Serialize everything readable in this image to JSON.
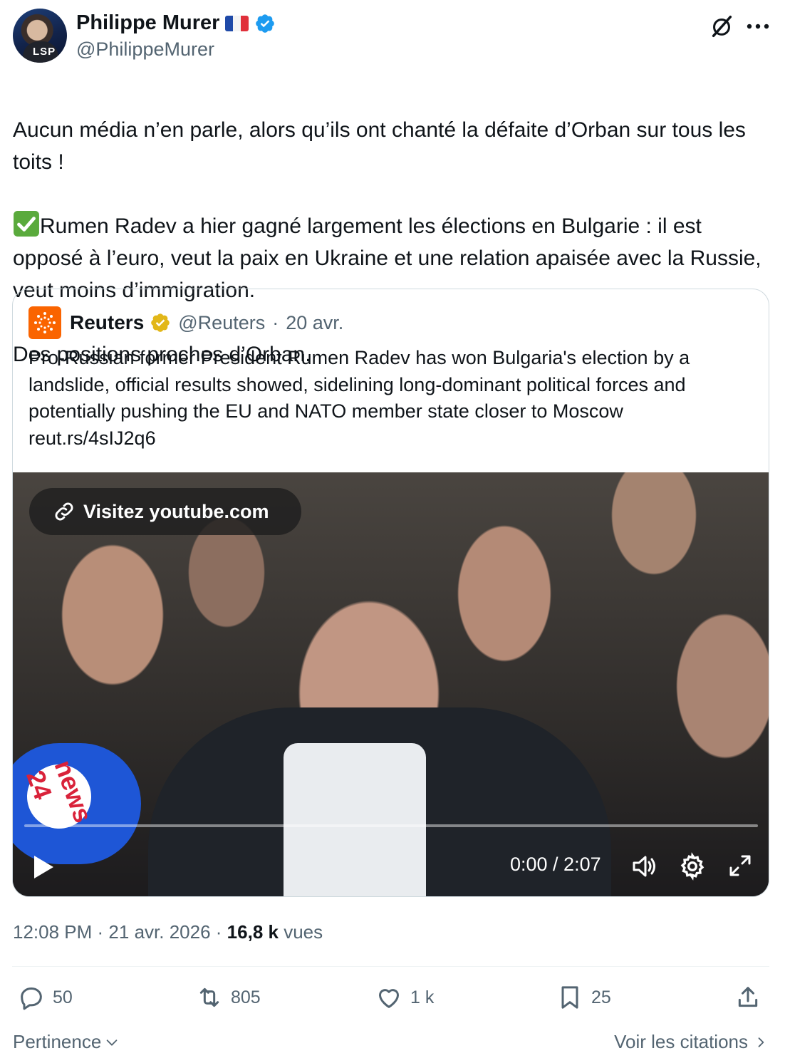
{
  "author": {
    "name": "Philippe Murer",
    "handle": "@PhilippeMurer",
    "avatar_text": "LSP",
    "verified_color": "#1d9bf0"
  },
  "tweet": {
    "text": "Aucun média n’en parle, alors qu’ils ont chanté la défaite d’Orban sur tous les toits !",
    "check_line": "Rumen Radev a hier gagné largement les élections en Bulgarie : il est opposé à l’euro, veut la paix en Ukraine et une relation apaisée avec la Russie, veut moins d’immigration.",
    "last_line": "Des positions proches d’Orban."
  },
  "quote": {
    "name": "Reuters",
    "handle": "@Reuters",
    "separator": "·",
    "date": "20 avr.",
    "brand_color": "#fa6400",
    "badge_color": "#e2b719",
    "text": "Pro-Russian former President Rumen Radev has won Bulgaria's election by a landslide, official results showed, sidelining long-dominant political forces and potentially pushing the EU and NATO member state closer to Moscow",
    "link": "reut.rs/4sIJ2q6"
  },
  "video": {
    "link_label": "Visitez youtube.com",
    "time": "0:00 / 2:07",
    "progress": 0,
    "mic_label": "news 24"
  },
  "meta": {
    "time": "12:08 PM",
    "date": "21 avr. 2026",
    "views_count": "16,8 k",
    "views_label": "vues"
  },
  "actions": {
    "replies": "50",
    "reposts": "805",
    "likes": "1 k",
    "bookmarks": "25"
  },
  "footer": {
    "sort_label": "Pertinence",
    "quotes_label": "Voir les citations"
  },
  "icons": [
    "grok-icon",
    "more-icon",
    "check-icon",
    "link-icon",
    "play-icon",
    "volume-icon",
    "gear-icon",
    "fullscreen-icon",
    "reply-icon",
    "repost-icon",
    "like-icon",
    "bookmark-icon",
    "share-icon",
    "chevron-down-icon",
    "chevron-right-icon"
  ]
}
